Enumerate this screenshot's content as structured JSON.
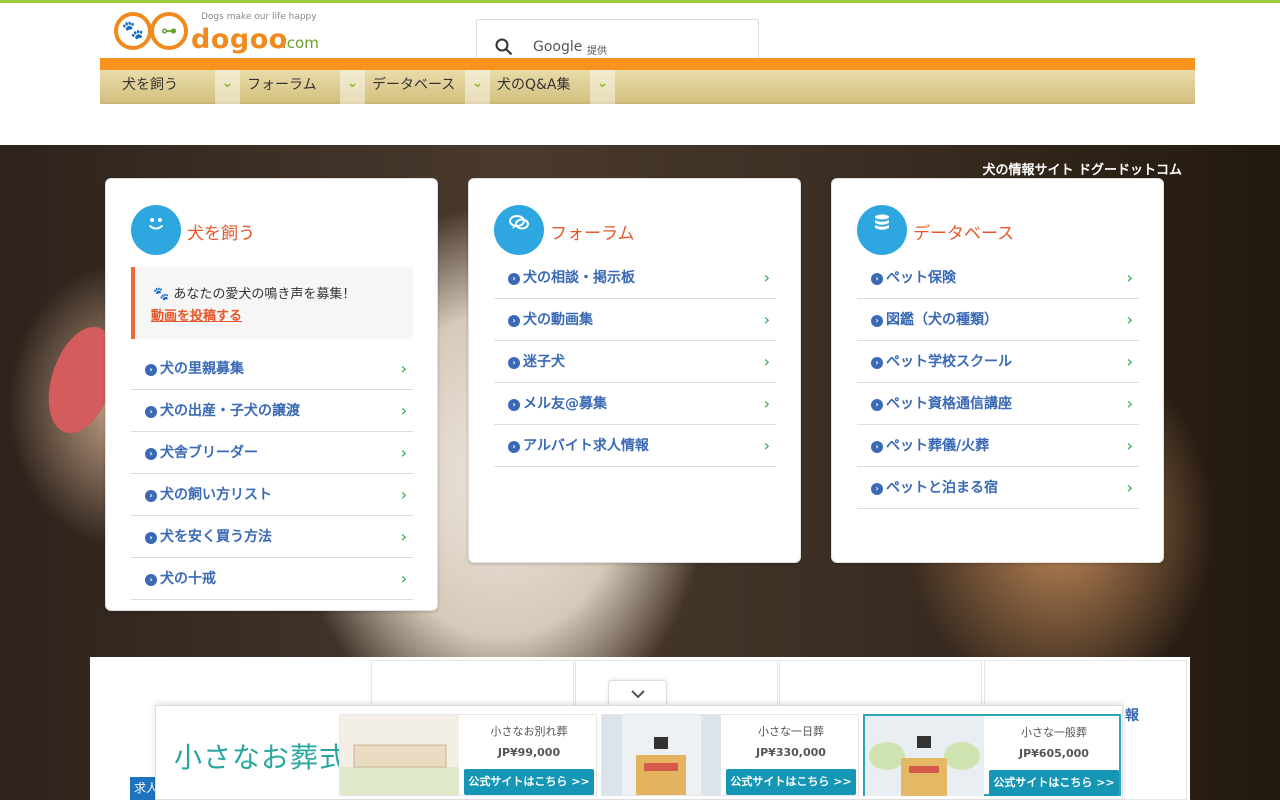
{
  "header": {
    "logo_tagline": "Dogs make our life happy",
    "logo_word": "dogoo",
    "logo_domain": ".com",
    "search_brand": "Google",
    "search_provided": "提供"
  },
  "nav": {
    "items": [
      {
        "label": "犬を飼う"
      },
      {
        "label": "フォーラム"
      },
      {
        "label": "データベース"
      },
      {
        "label": "犬のQ&A集"
      }
    ],
    "chevron": "⌄"
  },
  "hero": {
    "site_title": "犬の情報サイト ドグードットコム"
  },
  "cards": [
    {
      "title": "犬を飼う",
      "icon": "smile-icon",
      "notice_text": "あなたの愛犬の鳴き声を募集！",
      "notice_link": "動画を投稿する",
      "items": [
        "犬の里親募集",
        "犬の出産・子犬の譲渡",
        "犬舎ブリーダー",
        "犬の飼い方リスト",
        "犬を安く買う方法",
        "犬の十戒"
      ]
    },
    {
      "title": "フォーラム",
      "icon": "chat-bubbles-icon",
      "items": [
        "犬の相談・掲示板",
        "犬の動画集",
        "迷子犬",
        "メル友@募集",
        "アルバイト求人情報"
      ]
    },
    {
      "title": "データベース",
      "icon": "database-icon",
      "items": [
        "ペット保険",
        "図鑑（犬の種類）",
        "ペット学校スクール",
        "ペット資格通信講座",
        "ペット葬儀/火葬",
        "ペットと泊まる宿"
      ]
    }
  ],
  "lower": {
    "partial_text": "報",
    "badge_text": "求人"
  },
  "ad": {
    "brand": "小さなお葬式",
    "offers": [
      {
        "name": "小さなお別れ葬",
        "price": "JP¥99,000",
        "button": "公式サイトはこちら >>"
      },
      {
        "name": "小さな一日葬",
        "price": "JP¥330,000",
        "button": "公式サイトはこちら >>"
      },
      {
        "name": "小さな一般葬",
        "price": "JP¥605,000",
        "button": "公式サイトはこちら >>"
      }
    ]
  },
  "colors": {
    "accent_orange": "#f7931e",
    "accent_green": "#9cc83c",
    "link_blue": "#3a6ab5",
    "title_orange": "#e8562a",
    "icon_blue": "#2ea7e0",
    "ad_teal": "#1596b4"
  }
}
